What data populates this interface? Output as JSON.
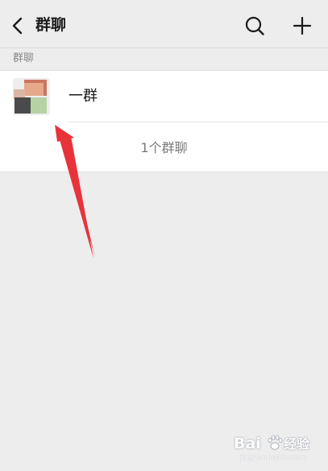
{
  "header": {
    "title": "群聊",
    "icons": {
      "back": "chevron-left-icon",
      "search": "search-icon",
      "add": "plus-icon"
    }
  },
  "section": {
    "label": "群聊"
  },
  "groups": [
    {
      "name": "一群",
      "avatar": "group-avatar"
    }
  ],
  "footer": {
    "count_text": "1个群聊"
  },
  "watermark": {
    "logo": "Bai",
    "sub": "经验",
    "url": "jingyan.baidu.com"
  },
  "colors": {
    "background": "#ededed",
    "panel": "#ffffff",
    "arrow": "#e8333a"
  }
}
